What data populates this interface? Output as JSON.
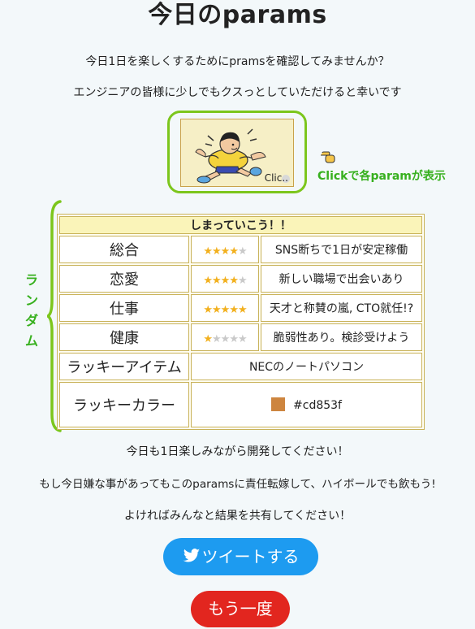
{
  "title": "今日のparams",
  "intro": [
    "今日1日を楽しくするためにpramsを確認してみませんか？",
    "エンジニアの皆様に少しでもクスっとしていただけると幸いです"
  ],
  "hero": {
    "click_text": "Clic.."
  },
  "click_note": "Clickで各paramが表示",
  "side_label": [
    "ラ",
    "ン",
    "ダ",
    "ム"
  ],
  "table": {
    "header": "しまっていこう！！",
    "rows": [
      {
        "label": "総合",
        "stars": 4,
        "text": "SNS断ちで1日が安定稼働"
      },
      {
        "label": "恋愛",
        "stars": 4,
        "text": "新しい職場で出会いあり"
      },
      {
        "label": "仕事",
        "stars": 5,
        "text": "天才と称賛の嵐, CTO就任!?"
      },
      {
        "label": "健康",
        "stars": 1,
        "text": "脆弱性あり。検診受けよう"
      }
    ],
    "lucky_item": {
      "label": "ラッキーアイテム",
      "value": "NECのノートパソコン"
    },
    "lucky_color": {
      "label": "ラッキーカラー",
      "value": "#cd853f"
    }
  },
  "outro": [
    "今日も1日楽しみながら開発してください！",
    "もし今日嫌な事があってもこのparamsに責任転嫁して、ハイボールでも飲もう!",
    "よければみんなと結果を共有してください！"
  ],
  "buttons": {
    "tweet": "ツイートする",
    "retry": "もう一度"
  },
  "colors": {
    "accent_green": "#37b01e",
    "twitter_blue": "#1d9bf0",
    "retry_red": "#e2261f",
    "star_gold": "#f2b01e"
  }
}
